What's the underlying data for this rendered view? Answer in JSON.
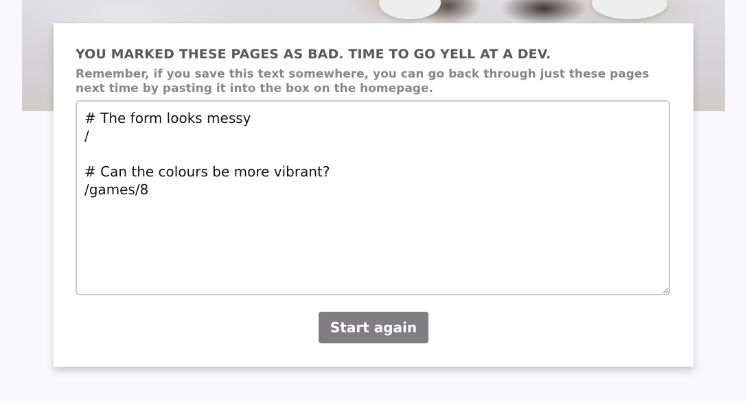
{
  "hero": {
    "image_alt": "kitten photo"
  },
  "results": {
    "heading": "YOU MARKED THESE PAGES AS BAD. TIME TO GO YELL AT A DEV.",
    "subtext": "Remember, if you save this text somewhere, you can go back through just these pages next time by pasting it into the box on the homepage.",
    "notes_value": "# The form looks messy\n/\n\n# Can the colours be more vibrant?\n/games/8",
    "start_label": "Start again"
  },
  "colors": {
    "button": "#807e83",
    "heading": "#5a585d",
    "subtext": "#88868b"
  }
}
